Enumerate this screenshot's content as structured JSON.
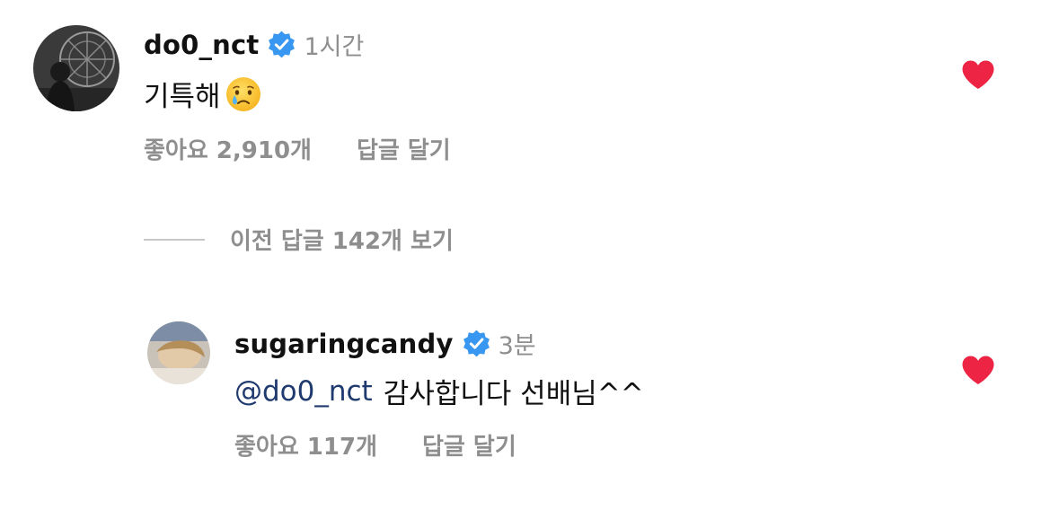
{
  "colors": {
    "text": "#111111",
    "muted": "#8e8e8e",
    "mention": "#1f3a6e",
    "verified": "#3897f0",
    "heart": "#ed2443"
  },
  "comments": [
    {
      "username": "do0_nct",
      "time": "1시간",
      "text": "기특해",
      "emoji": "crying-face",
      "likes": "좋아요 2,910개",
      "reply_label": "답글 달기",
      "liked": true
    }
  ],
  "view_replies": {
    "label": "이전 답글 142개 보기"
  },
  "replies": [
    {
      "username": "sugaringcandy",
      "time": "3분",
      "mention": "@do0_nct",
      "text": "감사합니다 선배님^^",
      "likes": "좋아요 117개",
      "reply_label": "답글 달기",
      "liked": true
    }
  ]
}
